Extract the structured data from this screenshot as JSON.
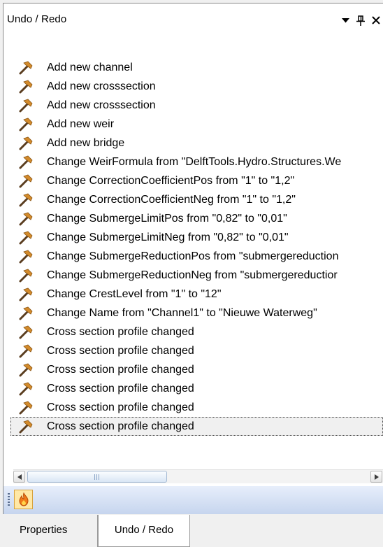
{
  "panel": {
    "title": "Undo / Redo",
    "buttons": {
      "dropdown": "dropdown-icon",
      "pin": "pin-icon",
      "close": "close-icon"
    }
  },
  "history": [
    {
      "label": "Add new channel",
      "icon": "hammer-icon"
    },
    {
      "label": "Add new crosssection",
      "icon": "hammer-icon"
    },
    {
      "label": "Add new crosssection",
      "icon": "hammer-icon"
    },
    {
      "label": "Add new weir",
      "icon": "hammer-icon"
    },
    {
      "label": "Add new bridge",
      "icon": "hammer-icon"
    },
    {
      "label": "Change WeirFormula from \"DelftTools.Hydro.Structures.We",
      "icon": "hammer-icon"
    },
    {
      "label": "Change CorrectionCoefficientPos from \"1\" to \"1,2\"",
      "icon": "hammer-icon"
    },
    {
      "label": "Change CorrectionCoefficientNeg from \"1\" to \"1,2\"",
      "icon": "hammer-icon"
    },
    {
      "label": "Change SubmergeLimitPos from \"0,82\" to \"0,01\"",
      "icon": "hammer-icon"
    },
    {
      "label": "Change SubmergeLimitNeg from \"0,82\" to \"0,01\"",
      "icon": "hammer-icon"
    },
    {
      "label": "Change SubmergeReductionPos from \"submergereduction",
      "icon": "hammer-icon"
    },
    {
      "label": "Change SubmergeReductionNeg from \"submergereductior",
      "icon": "hammer-icon"
    },
    {
      "label": "Change CrestLevel from \"1\" to \"12\"",
      "icon": "hammer-icon"
    },
    {
      "label": "Change Name from \"Channel1\" to \"Nieuwe Waterweg\"",
      "icon": "hammer-icon"
    },
    {
      "label": "Cross section profile changed",
      "icon": "hammer-icon"
    },
    {
      "label": "Cross section profile changed",
      "icon": "hammer-icon"
    },
    {
      "label": "Cross section profile changed",
      "icon": "hammer-icon"
    },
    {
      "label": "Cross section profile changed",
      "icon": "hammer-icon"
    },
    {
      "label": "Cross section profile changed",
      "icon": "hammer-icon"
    },
    {
      "label": "Cross section profile changed",
      "icon": "hammer-icon",
      "selected": true
    }
  ],
  "scrollbar": {
    "position": 0.0
  },
  "toolstrip": {
    "tool_icon": "flame-icon"
  },
  "tabs": [
    {
      "label": "Properties",
      "active": false
    },
    {
      "label": "Undo / Redo",
      "active": true
    }
  ],
  "colors": {
    "selection_background": "#f0f0f0",
    "toolstrip_top": "#e7eefb",
    "toolstrip_bottom": "#c6d5ee",
    "tool_button": "#ffe8a6",
    "hammer_head": "#d38b2c",
    "hammer_handle": "#5a3d1f"
  }
}
